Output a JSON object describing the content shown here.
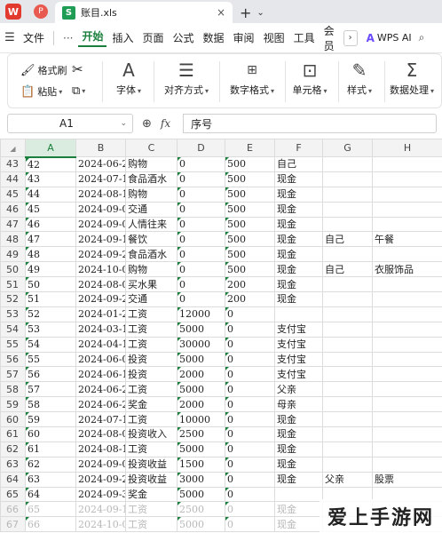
{
  "titlebar": {
    "logo": "W",
    "pdf_tab": "P",
    "file_icon": "S",
    "active_tab": "账目.xls",
    "close": "×",
    "plus": "+",
    "dropdown": "⌄"
  },
  "menubar": {
    "file": "文件",
    "more": "···",
    "items": [
      "开始",
      "插入",
      "页面",
      "公式",
      "数据",
      "审阅",
      "视图",
      "工具",
      "会员"
    ],
    "arrow": "›",
    "ai": "WPS AI",
    "search_icon": "search-icon"
  },
  "ribbon": {
    "format_painter": "格式刷",
    "paste": "粘贴",
    "font": "字体",
    "align": "对齐方式",
    "number_format": "数字格式",
    "cell": "单元格",
    "style": "样式",
    "data_process": "数据处理"
  },
  "formula_bar": {
    "cell_ref": "A1",
    "fx": "fx",
    "content": "序号"
  },
  "grid": {
    "columns": [
      "A",
      "B",
      "C",
      "D",
      "E",
      "F",
      "G",
      "H"
    ],
    "rows": [
      {
        "n": "43",
        "cells": [
          "42",
          "2024-06-2",
          "购物",
          "0",
          "500",
          "自己",
          "",
          ""
        ]
      },
      {
        "n": "44",
        "cells": [
          "43",
          "2024-07-1",
          "食品酒水",
          "0",
          "500",
          "现金",
          "",
          ""
        ]
      },
      {
        "n": "45",
        "cells": [
          "44",
          "2024-08-1",
          "购物",
          "0",
          "500",
          "现金",
          "",
          ""
        ]
      },
      {
        "n": "46",
        "cells": [
          "45",
          "2024-09-0",
          "交通",
          "0",
          "500",
          "现金",
          "",
          ""
        ]
      },
      {
        "n": "47",
        "cells": [
          "46",
          "2024-09-0",
          "人情往来",
          "0",
          "500",
          "现金",
          "",
          ""
        ]
      },
      {
        "n": "48",
        "cells": [
          "47",
          "2024-09-1",
          "餐饮",
          "0",
          "500",
          "现金",
          "自己",
          "午餐"
        ]
      },
      {
        "n": "49",
        "cells": [
          "48",
          "2024-09-2",
          "食品酒水",
          "0",
          "500",
          "现金",
          "",
          ""
        ]
      },
      {
        "n": "50",
        "cells": [
          "49",
          "2024-10-0",
          "购物",
          "0",
          "500",
          "现金",
          "自己",
          "衣服饰品"
        ]
      },
      {
        "n": "51",
        "cells": [
          "50",
          "2024-08-0",
          "买水果",
          "0",
          "200",
          "现金",
          "",
          ""
        ]
      },
      {
        "n": "52",
        "cells": [
          "51",
          "2024-09-2",
          "交通",
          "0",
          "200",
          "现金",
          "",
          ""
        ]
      },
      {
        "n": "53",
        "cells": [
          "52",
          "2024-01-2",
          "工资",
          "12000",
          "0",
          "",
          "",
          ""
        ]
      },
      {
        "n": "54",
        "cells": [
          "53",
          "2024-03-1",
          "工资",
          "5000",
          "0",
          "支付宝",
          "",
          ""
        ]
      },
      {
        "n": "55",
        "cells": [
          "54",
          "2024-04-1",
          "工资",
          "30000",
          "0",
          "支付宝",
          "",
          ""
        ]
      },
      {
        "n": "56",
        "cells": [
          "55",
          "2024-06-0",
          "投资",
          "5000",
          "0",
          "支付宝",
          "",
          ""
        ]
      },
      {
        "n": "57",
        "cells": [
          "56",
          "2024-06-1",
          "投资",
          "2000",
          "0",
          "支付宝",
          "",
          ""
        ]
      },
      {
        "n": "58",
        "cells": [
          "57",
          "2024-06-2",
          "工资",
          "5000",
          "0",
          "父亲",
          "",
          ""
        ]
      },
      {
        "n": "59",
        "cells": [
          "58",
          "2024-06-2",
          "奖金",
          "2000",
          "0",
          "母亲",
          "",
          ""
        ]
      },
      {
        "n": "60",
        "cells": [
          "59",
          "2024-07-1",
          "工资",
          "10000",
          "0",
          "现金",
          "",
          ""
        ]
      },
      {
        "n": "61",
        "cells": [
          "60",
          "2024-08-0",
          "投资收入",
          "2500",
          "0",
          "现金",
          "",
          ""
        ]
      },
      {
        "n": "62",
        "cells": [
          "61",
          "2024-08-1",
          "工资",
          "5000",
          "0",
          "现金",
          "",
          ""
        ]
      },
      {
        "n": "63",
        "cells": [
          "62",
          "2024-09-0",
          "投资收益",
          "1500",
          "0",
          "现金",
          "",
          ""
        ]
      },
      {
        "n": "64",
        "cells": [
          "63",
          "2024-09-2",
          "投资收益",
          "3000",
          "0",
          "现金",
          "父亲",
          "股票"
        ]
      },
      {
        "n": "65",
        "cells": [
          "64",
          "2024-09-3",
          "奖金",
          "5000",
          "0",
          "",
          "",
          ""
        ]
      },
      {
        "n": "66",
        "cells": [
          "65",
          "2024-09-1",
          "工资",
          "2500",
          "0",
          "现金",
          "",
          ""
        ]
      },
      {
        "n": "67",
        "cells": [
          "66",
          "2024-10-0",
          "工资",
          "5000",
          "0",
          "现金",
          "",
          ""
        ]
      }
    ]
  },
  "watermark": "爱上手游网"
}
